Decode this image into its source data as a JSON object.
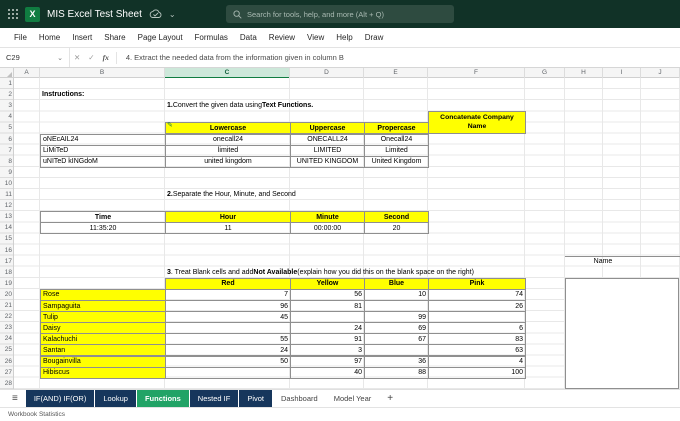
{
  "titlebar": {
    "doc_title": "MIS Excel Test Sheet",
    "search_placeholder": "Search for tools, help, and more (Alt + Q)"
  },
  "menubar": {
    "items": [
      "File",
      "Home",
      "Insert",
      "Share",
      "Page Layout",
      "Formulas",
      "Data",
      "Review",
      "View",
      "Help",
      "Draw"
    ]
  },
  "formula_bar": {
    "name_box": "C29",
    "formula": "4. Extract the needed data from the information given in column B"
  },
  "grid": {
    "columns": [
      "A",
      "B",
      "C",
      "D",
      "E",
      "F",
      "G",
      "H",
      "I",
      "J"
    ],
    "selected_column": "C",
    "rows": 28,
    "annotation": {
      "start_col": "H",
      "name_line_row": 17,
      "box_start_row": 19,
      "box_end_row": 28
    },
    "cells": [
      {
        "r": 2,
        "c": "B",
        "t": "Instructions:",
        "bold": true,
        "spill": true
      },
      {
        "r": 3,
        "c": "C",
        "spill": true,
        "parts": [
          {
            "t": "1.",
            "bold": true
          },
          {
            "t": "Convert the given data using "
          },
          {
            "t": "Text Functions.",
            "bold": true
          }
        ]
      },
      {
        "r": 4,
        "c": "F",
        "t": "Concatenate Company Name",
        "bg": "yellow",
        "border": true,
        "bold": true,
        "align": "center",
        "rowspan": 2,
        "wrap": true
      },
      {
        "r": 5,
        "c": "C",
        "t": "Lowercase",
        "bg": "yellow",
        "border": true,
        "bold": true,
        "align": "center"
      },
      {
        "r": 5,
        "c": "D",
        "t": "Uppercase",
        "bg": "yellow",
        "border": true,
        "bold": true,
        "align": "center"
      },
      {
        "r": 5,
        "c": "E",
        "t": "Propercase",
        "bg": "yellow",
        "border": true,
        "bold": true,
        "align": "center"
      },
      {
        "r": 6,
        "c": "B",
        "t": "oNEcAIL24",
        "border": true
      },
      {
        "r": 6,
        "c": "C",
        "t": "onecall24",
        "border": true,
        "align": "center"
      },
      {
        "r": 6,
        "c": "D",
        "t": "ONECALL24",
        "border": true,
        "align": "center"
      },
      {
        "r": 6,
        "c": "E",
        "t": "Onecall24",
        "border": true,
        "align": "center"
      },
      {
        "r": 7,
        "c": "B",
        "t": "LiMiTeD",
        "border": true
      },
      {
        "r": 7,
        "c": "C",
        "t": "limited",
        "border": true,
        "align": "center"
      },
      {
        "r": 7,
        "c": "D",
        "t": "LIMITED",
        "border": true,
        "align": "center"
      },
      {
        "r": 7,
        "c": "E",
        "t": "Limited",
        "border": true,
        "align": "center"
      },
      {
        "r": 8,
        "c": "B",
        "t": "uNITeD kINGdoM",
        "border": true
      },
      {
        "r": 8,
        "c": "C",
        "t": "united kingdom",
        "border": true,
        "align": "center"
      },
      {
        "r": 8,
        "c": "D",
        "t": "UNITED KINGDOM",
        "border": true,
        "align": "center"
      },
      {
        "r": 8,
        "c": "E",
        "t": "United Kingdom",
        "border": true,
        "align": "center"
      },
      {
        "r": 11,
        "c": "C",
        "spill": true,
        "parts": [
          {
            "t": "2.",
            "bold": true
          },
          {
            "t": "Separate the Hour, Minute, and Second"
          }
        ]
      },
      {
        "r": 13,
        "c": "B",
        "t": "Time",
        "border": true,
        "bold": true,
        "align": "center"
      },
      {
        "r": 13,
        "c": "C",
        "t": "Hour",
        "bg": "yellow",
        "border": true,
        "bold": true,
        "align": "center"
      },
      {
        "r": 13,
        "c": "D",
        "t": "Minute",
        "bg": "yellow",
        "border": true,
        "bold": true,
        "align": "center"
      },
      {
        "r": 13,
        "c": "E",
        "t": "Second",
        "bg": "yellow",
        "border": true,
        "bold": true,
        "align": "center"
      },
      {
        "r": 14,
        "c": "B",
        "t": "11:35:20",
        "border": true,
        "align": "center"
      },
      {
        "r": 14,
        "c": "C",
        "t": "11",
        "border": true,
        "align": "center"
      },
      {
        "r": 14,
        "c": "D",
        "t": "00:00:00",
        "border": true,
        "align": "center"
      },
      {
        "r": 14,
        "c": "E",
        "t": "20",
        "border": true,
        "align": "center"
      },
      {
        "r": 17,
        "c": "H",
        "t": "Name",
        "align": "center",
        "colspan": 2
      },
      {
        "r": 18,
        "c": "C",
        "spill": true,
        "parts": [
          {
            "t": "3",
            "bold": true
          },
          {
            "t": ". Treat Blank cells and add "
          },
          {
            "t": "Not Available",
            "bold": true
          },
          {
            "t": " (explain how you did this on the blank space on the right)"
          }
        ]
      },
      {
        "r": 19,
        "c": "C",
        "t": "Red",
        "bg": "yellow",
        "border": true,
        "bold": true,
        "align": "center"
      },
      {
        "r": 19,
        "c": "D",
        "t": "Yellow",
        "bg": "yellow",
        "border": true,
        "bold": true,
        "align": "center"
      },
      {
        "r": 19,
        "c": "E",
        "t": "Blue",
        "bg": "yellow",
        "border": true,
        "bold": true,
        "align": "center"
      },
      {
        "r": 19,
        "c": "F",
        "t": "Pink",
        "bg": "yellow",
        "border": true,
        "bold": true,
        "align": "center"
      },
      {
        "r": 20,
        "c": "B",
        "t": "Rose",
        "bg": "yellow",
        "border": true
      },
      {
        "r": 20,
        "c": "C",
        "t": "7",
        "border": true,
        "align": "right"
      },
      {
        "r": 20,
        "c": "D",
        "t": "56",
        "border": true,
        "align": "right"
      },
      {
        "r": 20,
        "c": "E",
        "t": "10",
        "border": true,
        "align": "right"
      },
      {
        "r": 20,
        "c": "F",
        "t": "74",
        "border": true,
        "align": "right"
      },
      {
        "r": 21,
        "c": "B",
        "t": "Sampaguita",
        "bg": "yellow",
        "border": true
      },
      {
        "r": 21,
        "c": "C",
        "t": "96",
        "border": true,
        "align": "right"
      },
      {
        "r": 21,
        "c": "D",
        "t": "81",
        "border": true,
        "align": "right"
      },
      {
        "r": 21,
        "c": "E",
        "t": "",
        "border": true
      },
      {
        "r": 21,
        "c": "F",
        "t": "26",
        "border": true,
        "align": "right"
      },
      {
        "r": 22,
        "c": "B",
        "t": "Tulip",
        "bg": "yellow",
        "border": true
      },
      {
        "r": 22,
        "c": "C",
        "t": "45",
        "border": true,
        "align": "right"
      },
      {
        "r": 22,
        "c": "D",
        "t": "",
        "border": true
      },
      {
        "r": 22,
        "c": "E",
        "t": "99",
        "border": true,
        "align": "right"
      },
      {
        "r": 22,
        "c": "F",
        "t": "",
        "border": true
      },
      {
        "r": 23,
        "c": "B",
        "t": "Daisy",
        "bg": "yellow",
        "border": true
      },
      {
        "r": 23,
        "c": "C",
        "t": "",
        "border": true
      },
      {
        "r": 23,
        "c": "D",
        "t": "24",
        "border": true,
        "align": "right"
      },
      {
        "r": 23,
        "c": "E",
        "t": "69",
        "border": true,
        "align": "right"
      },
      {
        "r": 23,
        "c": "F",
        "t": "6",
        "border": true,
        "align": "right"
      },
      {
        "r": 24,
        "c": "B",
        "t": "Kalachuchi",
        "bg": "yellow",
        "border": true
      },
      {
        "r": 24,
        "c": "C",
        "t": "55",
        "border": true,
        "align": "right"
      },
      {
        "r": 24,
        "c": "D",
        "t": "91",
        "border": true,
        "align": "right"
      },
      {
        "r": 24,
        "c": "E",
        "t": "67",
        "border": true,
        "align": "right"
      },
      {
        "r": 24,
        "c": "F",
        "t": "83",
        "border": true,
        "align": "right"
      },
      {
        "r": 25,
        "c": "B",
        "t": "Santan",
        "bg": "yellow",
        "border": true
      },
      {
        "r": 25,
        "c": "C",
        "t": "24",
        "border": true,
        "align": "right"
      },
      {
        "r": 25,
        "c": "D",
        "t": "3",
        "border": true,
        "align": "right"
      },
      {
        "r": 25,
        "c": "E",
        "t": "",
        "border": true
      },
      {
        "r": 25,
        "c": "F",
        "t": "63",
        "border": true,
        "align": "right"
      },
      {
        "r": 26,
        "c": "B",
        "t": "Bougainvilla",
        "bg": "yellow",
        "border": true
      },
      {
        "r": 26,
        "c": "C",
        "t": "50",
        "border": true,
        "align": "right"
      },
      {
        "r": 26,
        "c": "D",
        "t": "97",
        "border": true,
        "align": "right"
      },
      {
        "r": 26,
        "c": "E",
        "t": "36",
        "border": true,
        "align": "right"
      },
      {
        "r": 26,
        "c": "F",
        "t": "4",
        "border": true,
        "align": "right"
      },
      {
        "r": 27,
        "c": "B",
        "t": "Hibiscus",
        "bg": "yellow",
        "border": true
      },
      {
        "r": 27,
        "c": "C",
        "t": "",
        "border": true
      },
      {
        "r": 27,
        "c": "D",
        "t": "40",
        "border": true,
        "align": "right"
      },
      {
        "r": 27,
        "c": "E",
        "t": "88",
        "border": true,
        "align": "right"
      },
      {
        "r": 27,
        "c": "F",
        "t": "100",
        "border": true,
        "align": "right"
      }
    ]
  },
  "sheet_tabs": {
    "tabs": [
      {
        "label": "IF(AND) IF(OR)",
        "style": "navy"
      },
      {
        "label": "Lookup",
        "style": "navy"
      },
      {
        "label": "Functions",
        "style": "green",
        "active": true
      },
      {
        "label": "Nested IF",
        "style": "navy"
      },
      {
        "label": "Pivot",
        "style": "navy"
      },
      {
        "label": "Dashboard",
        "style": "plain"
      },
      {
        "label": "Model Year",
        "style": "plain"
      }
    ],
    "add_label": "+"
  },
  "status_bar": {
    "left": "Workbook Statistics"
  },
  "icons": {
    "excel_logo": "X",
    "chevron": "⌄",
    "cancel": "✕",
    "enter": "✓",
    "insert_function": "fx",
    "sheet_menu": "≡",
    "edit_cursor": "✎"
  },
  "colors": {
    "topbar_bg": "#113227",
    "search_bg": "#2E4B40",
    "excel_green": "#107C41",
    "tab_green": "#21A366",
    "tab_navy": "#16365C",
    "cell_yellow": "#FFFF00",
    "selected_header_bg": "#CDE8DA",
    "selected_header_text": "#0E5C39"
  }
}
